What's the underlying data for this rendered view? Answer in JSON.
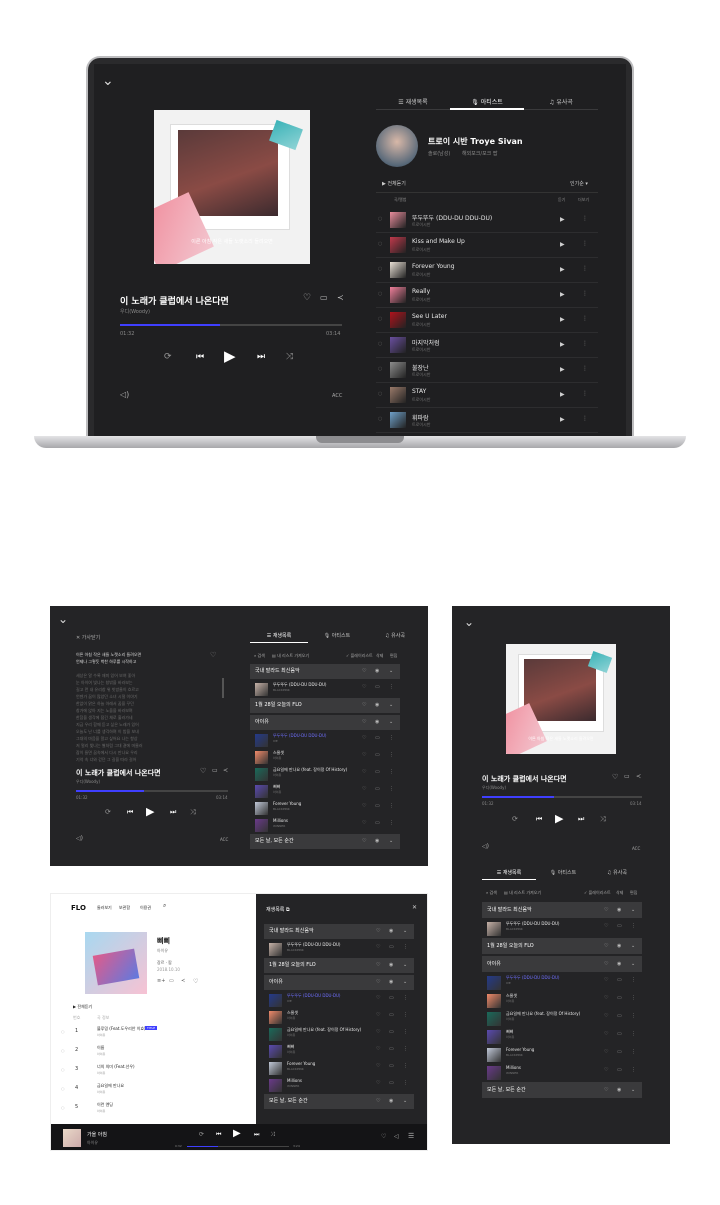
{
  "laptop": {
    "left": {
      "song_title": "이 노래가 클럽에서 나온다면",
      "artist": "우디(Woody)",
      "elapsed": "01:32",
      "duration": "03:14",
      "progress": 0.45,
      "cover_caption": "이른 아침 작은 새들 노랫소리 들려오면",
      "acc": "ACC",
      "accent": "#3f3fff"
    },
    "tabs": [
      {
        "icon": "list-icon",
        "label": "재생목록"
      },
      {
        "icon": "mic-icon",
        "label": "아티스트"
      },
      {
        "icon": "note-icon",
        "label": "유사곡"
      }
    ],
    "artist_name": "트로이 시반 Troye Sivan",
    "artist_meta": [
      "솔로(남성)",
      "해외포크/포크 팝"
    ],
    "play_all": "전체듣기",
    "sort": "인기순",
    "col_headers": [
      "곡/앨범",
      "듣기",
      "더보기"
    ],
    "tracks": [
      {
        "title": "뚜두뚜두 (DDU-DU DDU-DU)",
        "sub": "트로이시반",
        "color": "#e88c9c"
      },
      {
        "title": "Kiss and Make Up",
        "sub": "트로이시반",
        "color": "#c0394b"
      },
      {
        "title": "Forever Young",
        "sub": "트로이시반",
        "color": "#e9e0d5"
      },
      {
        "title": "Really",
        "sub": "트로이시반",
        "color": "#ef7f9a"
      },
      {
        "title": "See U Later",
        "sub": "트로이시반",
        "color": "#b0121c"
      },
      {
        "title": "마지막처럼",
        "sub": "트로이시반",
        "color": "#6a4fa0"
      },
      {
        "title": "불장난",
        "sub": "트로이시반",
        "color": "#8c8c8c"
      },
      {
        "title": "STAY",
        "sub": "트로이시반",
        "color": "#9a7a6a"
      },
      {
        "title": "휘파람",
        "sub": "트로이시반",
        "color": "#6fa0c8"
      }
    ]
  },
  "tablet": {
    "lyrics_tab": "가사닫기",
    "lyrics": [
      "이른 아침 작은 새들 노랫소리 들려오면",
      "언제나 그렇듯 벅찬 하루를 시작하고",
      "",
      "세상은 알 수록 재미 있어 보여 좋아",
      "눈 아이여 빛나는 창밖을 바라보는",
      "길고 먼 내 유리창 위 빗방울이 흐르고",
      "언젠가 꿈이 많았던 소녀 시절 이야기",
      "한없이 맑은 하늘 아래서 꿈을 꾸던",
      "창가에 앉아 지는 노을을 바라보며",
      "한참을 생각에 잠긴 채로 흘러가네",
      "지금 우리 함께 듣고 싶은 노래가 있어",
      "오늘도 난 너를 생각하며 이 밤을 보내",
      "그대의 마음을 알고 싶어요 나는 항상",
      "저 멀리 빛나는 별처럼 그대 곁에 머물러",
      "잠이 들면 꿈속에서 다시 만나요 우리",
      "기억 속 너와 걷던 그 길을 따라 걸어"
    ],
    "song_title": "이 노래가 클럽에서 나온다면",
    "artist": "우디(Woody)",
    "elapsed": "01:32",
    "duration": "03:14",
    "progress": 0.45,
    "acc": "ACC",
    "tabs": [
      "재생목록",
      "아티스트",
      "유사곡"
    ],
    "toolbar": [
      "검색",
      "내 리스트 가져오기",
      "플레이리스트",
      "삭제",
      "편집"
    ],
    "groups": [
      {
        "title": "국내 발라드 최신음악",
        "songs": [
          {
            "title": "뚜두뚜두 (DDU-DU DDU-DU)",
            "sub": "BLACKPINK",
            "color": "#c6b2a8"
          }
        ]
      },
      {
        "title": "1월 28일 오늘의 FLO",
        "songs": []
      },
      {
        "title": "아이유",
        "songs": [
          {
            "title": "뚜두뚜두 (DDU-DU DDU-DU)",
            "sub": "IVE",
            "color": "#243a8a"
          },
          {
            "title": "스물셋",
            "sub": "아이유",
            "color": "#f08a6a"
          },
          {
            "title": "금요일에 만나요 (feat. 장이정 Of History)",
            "sub": "아이유",
            "color": "#1a6a5a"
          },
          {
            "title": "삐삐",
            "sub": "아이유",
            "color": "#5a4ab0"
          }
        ]
      },
      {
        "title": "",
        "songs": [
          {
            "title": "Forever Young",
            "sub": "BLACKPINK",
            "color": "#c0c8d8"
          },
          {
            "title": "Millions",
            "sub": "WINNER",
            "color": "#6a3a8a"
          }
        ]
      },
      {
        "title": "모든 날, 모든 순간",
        "songs": []
      }
    ]
  },
  "web": {
    "logo": "FLO",
    "nav": [
      "둘러보기",
      "보관함",
      "이용권"
    ],
    "album_title": "삐삐",
    "album_artist": "아이유",
    "album_meta": [
      "장르 · 팝",
      "2018.10.10"
    ],
    "play_all": "전체듣기",
    "track_header": [
      "번호",
      "곡 정보"
    ],
    "tracks": [
      {
        "no": "1",
        "title": "블루밍 (Feat.도우리안 이효) ",
        "badge": "TITLE",
        "sub": "아이유"
      },
      {
        "no": "2",
        "title": "이름",
        "badge": "",
        "sub": "아이유"
      },
      {
        "no": "3",
        "title": "너의 의미 (Feat.선우)",
        "badge": "",
        "sub": "아이유"
      },
      {
        "no": "4",
        "title": "금요일에 만나요",
        "badge": "",
        "sub": "아이유"
      },
      {
        "no": "5",
        "title": "이런 엔딩",
        "badge": "",
        "sub": "아이유"
      }
    ],
    "panel_title": "재생목록",
    "panel_close": "닫기",
    "player_title": "가을 아침",
    "player_artist": "아이유",
    "player_elapsed": "0:32",
    "player_duration": "3:24",
    "player_progress": 0.3
  },
  "phone": {
    "song_title": "이 노래가 클럽에서 나온다면",
    "artist": "우디(Woody)",
    "elapsed": "01:32",
    "duration": "03:14",
    "progress": 0.45,
    "cover_caption": "이른 아침 작은 새들 노랫소리 들려오면",
    "acc": "ACC",
    "tabs": [
      "재생목록",
      "아티스트",
      "유사곡"
    ],
    "toolbar": [
      "검색",
      "내 리스트 가져오기",
      "플레이리스트",
      "삭제",
      "편집"
    ]
  }
}
